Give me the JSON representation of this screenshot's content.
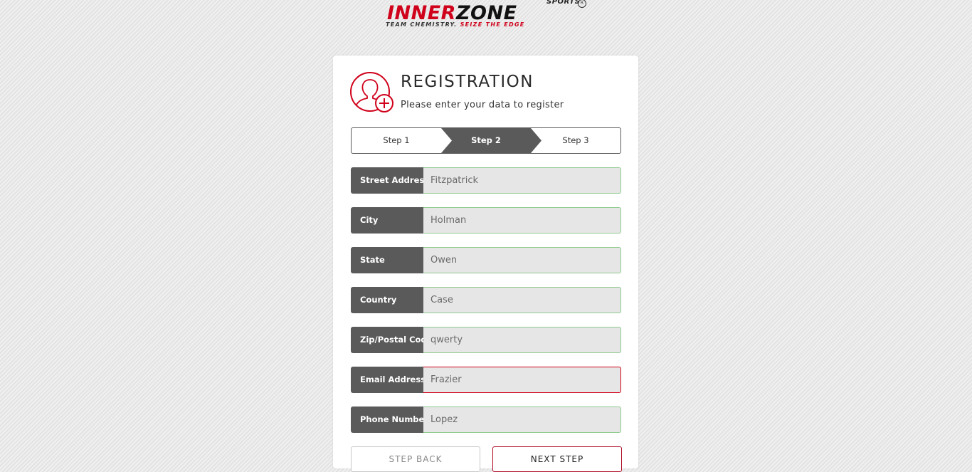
{
  "brand": {
    "logo_primary": "INNER",
    "logo_secondary": "ZONE",
    "logo_badge": "SPORTS",
    "tagline_part1": "TEAM CHEMISTRY.",
    "tagline_part2": "SEIZE THE EDGE",
    "accent_color": "#d0021b"
  },
  "header": {
    "icon": "user-add-icon",
    "title": "REGISTRATION",
    "subtitle": "Please enter your data to register"
  },
  "steps": {
    "items": [
      "Step 1",
      "Step 2",
      "Step 3"
    ],
    "active_index": 1
  },
  "fields": [
    {
      "label": "Street Address",
      "value": "Fitzpatrick",
      "valid": true
    },
    {
      "label": "City",
      "value": "Holman",
      "valid": true
    },
    {
      "label": "State",
      "value": "Owen",
      "valid": true
    },
    {
      "label": "Country",
      "value": "Case",
      "valid": true
    },
    {
      "label": "Zip/Postal Code",
      "value": "qwerty",
      "valid": true
    },
    {
      "label": "Email Address",
      "value": "Frazier",
      "valid": false
    },
    {
      "label": "Phone Number",
      "value": "Lopez",
      "valid": true
    }
  ],
  "buttons": {
    "back_label": "STEP BACK",
    "next_label": "NEXT STEP"
  },
  "colors": {
    "valid_border": "#8fcb8f",
    "invalid_border": "#d0021b",
    "label_bg": "#5a5a5a"
  }
}
